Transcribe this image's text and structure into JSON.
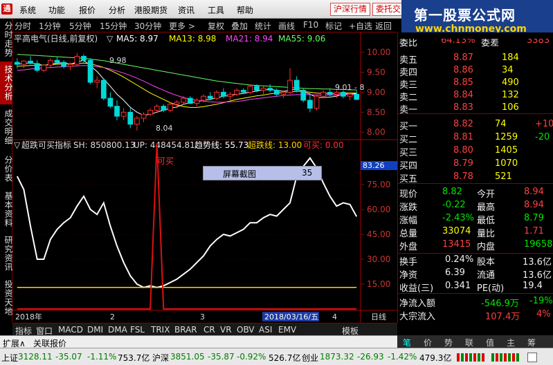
{
  "menubar": {
    "logo": "通",
    "items": [
      "系统",
      "功能",
      "报价",
      "分析",
      "港股期货",
      "资讯",
      "工具",
      "帮助"
    ],
    "btn_sh": "沪深行情",
    "btn_order": "委托交"
  },
  "watermark": {
    "line1": "第一股票公式网",
    "line2": "www.chnmoney.com"
  },
  "toolbar": {
    "left": [
      "分时",
      "1分钟",
      "5分钟",
      "15分钟",
      "30分钟",
      "更多 >"
    ],
    "right": [
      "复权",
      "叠加",
      "统计",
      "画线",
      "F10",
      "标记",
      "+自选",
      "返回"
    ]
  },
  "sidetabs": [
    "分时走势",
    "技术分析",
    "成交明细",
    "分价表",
    "基本资料",
    "研究资讯",
    "投资天地"
  ],
  "chart_info": {
    "stock": "平高电气(日线,前复权)",
    "ma5_label": "MA5: 8.97",
    "ma13_label": "MA13: 8.98",
    "ma21_label": "MA21: 8.94",
    "ma55_label": "MA55: 9.06",
    "hi_label": "9.98",
    "lo_label": "8.04",
    "last_label": "9.01 - 8"
  },
  "indicator_info": {
    "name": "超跌可买指标",
    "sh": "SH: 850800.13",
    "up": "UP: 448454.81",
    "trend": "趋势线: 55.73",
    "oversold": "超跌线: 13.00",
    "buy": "可买: 0.00",
    "buy_marker": "可买",
    "value_tag": "83.26"
  },
  "dialog": {
    "label": "屏幕截图",
    "value": "35"
  },
  "xaxis": {
    "year": "2018年",
    "m2": "2",
    "m3": "3",
    "date": "2018/03/16/五",
    "m4": "4",
    "period": "日线"
  },
  "bottomtabs": [
    "指标",
    "窗口",
    "MACD",
    "DMI",
    "DMA",
    "FSL",
    "TRIX",
    "BRAR",
    "CR",
    "VR",
    "OBV",
    "ASI",
    "EMV"
  ],
  "bottom_right": "模板",
  "expand": {
    "a": "扩展∧",
    "b": "关联报价"
  },
  "rtabs": [
    "笔",
    "价",
    "势",
    "联",
    "值",
    "主",
    "筹"
  ],
  "quote": {
    "weibi_label": "委比",
    "weibi": "64.13%",
    "weicha_label": "委差",
    "weicha": "3383",
    "sell": [
      {
        "label": "卖五",
        "price": "8.87",
        "vol": "184"
      },
      {
        "label": "卖四",
        "price": "8.86",
        "vol": "34"
      },
      {
        "label": "卖三",
        "price": "8.85",
        "vol": "490"
      },
      {
        "label": "卖二",
        "price": "8.84",
        "vol": "132"
      },
      {
        "label": "卖一",
        "price": "8.83",
        "vol": "106"
      }
    ],
    "buy": [
      {
        "label": "买一",
        "price": "8.82",
        "vol": "74",
        "chg": "+10"
      },
      {
        "label": "买二",
        "price": "8.81",
        "vol": "1259",
        "chg": "-20"
      },
      {
        "label": "买三",
        "price": "8.80",
        "vol": "1405",
        "chg": ""
      },
      {
        "label": "买四",
        "price": "8.79",
        "vol": "1070",
        "chg": ""
      },
      {
        "label": "买五",
        "price": "8.78",
        "vol": "521",
        "chg": ""
      }
    ],
    "stats": [
      {
        "l1": "现价",
        "v1": "8.82",
        "c1": "green",
        "l2": "今开",
        "v2": "8.94",
        "c2": "red"
      },
      {
        "l1": "涨跌",
        "v1": "-0.22",
        "c1": "green",
        "l2": "最高",
        "v2": "8.94",
        "c2": "red"
      },
      {
        "l1": "涨幅",
        "v1": "-2.43%",
        "c1": "green",
        "l2": "最低",
        "v2": "8.79",
        "c2": "green"
      },
      {
        "l1": "总量",
        "v1": "33074",
        "c1": "yellow",
        "l2": "量比",
        "v2": "1.71",
        "c2": "red"
      },
      {
        "l1": "外盘",
        "v1": "13415",
        "c1": "red",
        "l2": "内盘",
        "v2": "19658",
        "c2": "green"
      }
    ],
    "stats2": [
      {
        "l1": "换手",
        "v1": "0.24%",
        "l2": "股本",
        "v2": "13.6亿"
      },
      {
        "l1": "净资",
        "v1": "6.39",
        "l2": "流通",
        "v2": "13.6亿"
      },
      {
        "l1": "收益(三)",
        "v1": "0.341",
        "l2": "PE(动)",
        "v2": "19.4"
      }
    ],
    "inflow_label": "净流入额",
    "inflow": "-546.9万",
    "inflow_pct": "-19%",
    "block_label": "大宗流入",
    "block": "107.4万",
    "block_pct": "4%"
  },
  "statusbar": {
    "sh_label": "上证",
    "sh_val": "3128.11",
    "sh_chg": "-35.07",
    "sh_pct": "-1.11%",
    "sh_amt": "753.7亿",
    "sz_label": "沪深",
    "sz_val": "3851.05",
    "sz_chg": "-35.87",
    "sz_pct": "-0.92%",
    "sz_amt": "526.7亿",
    "cy_label": "创业",
    "cy_val": "1873.32",
    "cy_chg": "-26.93",
    "cy_pct": "-1.42%",
    "cy_amt": "479.3亿"
  },
  "chart_data": {
    "type": "line",
    "price_axis": {
      "ticks": [
        "10.00",
        "9.50",
        "9.00",
        "8.50",
        "8.00"
      ]
    },
    "indicator_axis": {
      "ticks": [
        "75.00",
        "60.00",
        "45.00",
        "30.00",
        "15.00"
      ]
    },
    "candles": [
      {
        "o": 9.75,
        "h": 9.85,
        "l": 9.6,
        "c": 9.7
      },
      {
        "o": 9.7,
        "h": 9.8,
        "l": 9.6,
        "c": 9.78
      },
      {
        "o": 9.78,
        "h": 9.9,
        "l": 9.7,
        "c": 9.72
      },
      {
        "o": 9.72,
        "h": 9.8,
        "l": 9.5,
        "c": 9.55
      },
      {
        "o": 9.55,
        "h": 9.7,
        "l": 9.5,
        "c": 9.68
      },
      {
        "o": 9.68,
        "h": 9.85,
        "l": 9.6,
        "c": 9.8
      },
      {
        "o": 9.8,
        "h": 9.9,
        "l": 9.7,
        "c": 9.75
      },
      {
        "o": 9.75,
        "h": 9.8,
        "l": 9.6,
        "c": 9.65
      },
      {
        "o": 9.65,
        "h": 9.75,
        "l": 9.55,
        "c": 9.7
      },
      {
        "o": 9.7,
        "h": 9.98,
        "l": 9.65,
        "c": 9.9
      },
      {
        "o": 9.9,
        "h": 9.95,
        "l": 9.75,
        "c": 9.8
      },
      {
        "o": 9.8,
        "h": 9.85,
        "l": 9.2,
        "c": 9.25
      },
      {
        "o": 9.25,
        "h": 9.4,
        "l": 9.1,
        "c": 9.3
      },
      {
        "o": 9.3,
        "h": 9.35,
        "l": 8.8,
        "c": 8.85
      },
      {
        "o": 8.85,
        "h": 9.0,
        "l": 8.6,
        "c": 8.65
      },
      {
        "o": 8.65,
        "h": 8.8,
        "l": 8.3,
        "c": 8.4
      },
      {
        "o": 8.4,
        "h": 8.6,
        "l": 8.3,
        "c": 8.5
      },
      {
        "o": 8.5,
        "h": 8.6,
        "l": 8.1,
        "c": 8.2
      },
      {
        "o": 8.2,
        "h": 8.4,
        "l": 8.04,
        "c": 8.35
      },
      {
        "o": 8.35,
        "h": 8.5,
        "l": 8.25,
        "c": 8.45
      },
      {
        "o": 8.45,
        "h": 8.6,
        "l": 8.4,
        "c": 8.55
      },
      {
        "o": 8.55,
        "h": 8.7,
        "l": 8.5,
        "c": 8.65
      },
      {
        "o": 8.65,
        "h": 8.7,
        "l": 8.5,
        "c": 8.55
      },
      {
        "o": 8.55,
        "h": 8.75,
        "l": 8.5,
        "c": 8.7
      },
      {
        "o": 8.7,
        "h": 8.8,
        "l": 8.6,
        "c": 8.75
      },
      {
        "o": 8.75,
        "h": 8.9,
        "l": 8.7,
        "c": 8.85
      },
      {
        "o": 8.85,
        "h": 8.9,
        "l": 8.7,
        "c": 8.72
      },
      {
        "o": 8.72,
        "h": 8.85,
        "l": 8.65,
        "c": 8.8
      },
      {
        "o": 8.8,
        "h": 8.95,
        "l": 8.75,
        "c": 8.9
      },
      {
        "o": 8.9,
        "h": 9.0,
        "l": 8.8,
        "c": 8.85
      },
      {
        "o": 8.85,
        "h": 9.05,
        "l": 8.8,
        "c": 9.0
      },
      {
        "o": 9.0,
        "h": 9.1,
        "l": 8.85,
        "c": 8.9
      },
      {
        "o": 8.9,
        "h": 9.0,
        "l": 8.8,
        "c": 8.95
      },
      {
        "o": 8.95,
        "h": 9.1,
        "l": 8.9,
        "c": 9.05
      },
      {
        "o": 9.05,
        "h": 9.1,
        "l": 8.95,
        "c": 9.0
      },
      {
        "o": 9.0,
        "h": 9.2,
        "l": 8.95,
        "c": 9.15
      },
      {
        "o": 9.15,
        "h": 9.2,
        "l": 9.0,
        "c": 9.05
      },
      {
        "o": 9.05,
        "h": 9.15,
        "l": 8.95,
        "c": 9.1
      },
      {
        "o": 9.1,
        "h": 9.2,
        "l": 9.0,
        "c": 9.05
      },
      {
        "o": 9.05,
        "h": 9.1,
        "l": 8.9,
        "c": 8.95
      },
      {
        "o": 8.95,
        "h": 9.05,
        "l": 8.85,
        "c": 9.0
      },
      {
        "o": 9.0,
        "h": 9.6,
        "l": 8.95,
        "c": 9.3
      },
      {
        "o": 9.3,
        "h": 9.4,
        "l": 9.0,
        "c": 9.05
      },
      {
        "o": 9.05,
        "h": 9.1,
        "l": 8.75,
        "c": 8.8
      },
      {
        "o": 8.8,
        "h": 9.0,
        "l": 8.5,
        "c": 8.6
      },
      {
        "o": 8.6,
        "h": 8.95,
        "l": 8.55,
        "c": 8.9
      },
      {
        "o": 8.9,
        "h": 9.05,
        "l": 8.85,
        "c": 9.0
      },
      {
        "o": 9.0,
        "h": 9.1,
        "l": 8.9,
        "c": 8.95
      },
      {
        "o": 8.95,
        "h": 9.05,
        "l": 8.85,
        "c": 9.0
      },
      {
        "o": 9.0,
        "h": 9.05,
        "l": 8.85,
        "c": 8.9
      },
      {
        "o": 8.9,
        "h": 9.0,
        "l": 8.8,
        "c": 8.95
      },
      {
        "o": 8.95,
        "h": 9.05,
        "l": 8.8,
        "c": 8.82
      }
    ],
    "ma_series": [
      {
        "name": "MA5",
        "color": "#ffffff",
        "values": [
          9.7,
          9.72,
          9.74,
          9.7,
          9.68,
          9.7,
          9.73,
          9.74,
          9.7,
          9.76,
          9.8,
          9.66,
          9.52,
          9.33,
          9.15,
          8.95,
          8.8,
          8.62,
          8.5,
          8.42,
          8.45,
          8.5,
          8.55,
          8.6,
          8.63,
          8.7,
          8.74,
          8.76,
          8.8,
          8.82,
          8.86,
          8.9,
          8.92,
          8.95,
          8.97,
          9.0,
          9.03,
          9.06,
          9.07,
          9.05,
          9.02,
          9.06,
          9.08,
          9.02,
          8.95,
          8.87,
          8.87,
          8.88,
          8.9,
          8.96,
          8.95,
          8.97
        ]
      },
      {
        "name": "MA13",
        "color": "#ffff00",
        "values": [
          9.65,
          9.66,
          9.67,
          9.68,
          9.68,
          9.69,
          9.7,
          9.71,
          9.71,
          9.72,
          9.73,
          9.71,
          9.67,
          9.62,
          9.55,
          9.47,
          9.38,
          9.28,
          9.18,
          9.08,
          8.98,
          8.9,
          8.82,
          8.74,
          8.68,
          8.64,
          8.62,
          8.62,
          8.64,
          8.67,
          8.7,
          8.74,
          8.78,
          8.82,
          8.85,
          8.88,
          8.91,
          8.93,
          8.96,
          8.98,
          9.0,
          9.01,
          9.02,
          9.02,
          9.0,
          8.98,
          8.97,
          8.97,
          8.97,
          8.98,
          8.98,
          8.98
        ]
      },
      {
        "name": "MA21",
        "color": "#ff44ff",
        "values": [
          9.55,
          9.56,
          9.58,
          9.6,
          9.61,
          9.62,
          9.63,
          9.64,
          9.65,
          9.66,
          9.67,
          9.66,
          9.64,
          9.62,
          9.58,
          9.53,
          9.48,
          9.42,
          9.35,
          9.28,
          9.2,
          9.12,
          9.05,
          8.98,
          8.92,
          8.87,
          8.83,
          8.8,
          8.78,
          8.76,
          8.75,
          8.75,
          8.76,
          8.77,
          8.79,
          8.82,
          8.84,
          8.86,
          8.88,
          8.9,
          8.92,
          8.93,
          8.94,
          8.94,
          8.94,
          8.93,
          8.93,
          8.93,
          8.93,
          8.94,
          8.94,
          8.94
        ]
      },
      {
        "name": "MA55",
        "color": "#66ff66",
        "values": [
          9.95,
          9.94,
          9.93,
          9.92,
          9.91,
          9.9,
          9.89,
          9.88,
          9.87,
          9.86,
          9.85,
          9.83,
          9.81,
          9.79,
          9.76,
          9.73,
          9.7,
          9.67,
          9.64,
          9.61,
          9.58,
          9.55,
          9.52,
          9.49,
          9.46,
          9.43,
          9.4,
          9.37,
          9.34,
          9.31,
          9.28,
          9.26,
          9.24,
          9.22,
          9.2,
          9.18,
          9.17,
          9.16,
          9.15,
          9.14,
          9.13,
          9.12,
          9.11,
          9.1,
          9.09,
          9.09,
          9.08,
          9.08,
          9.07,
          9.07,
          9.06,
          9.06
        ]
      }
    ],
    "indicator_series": [
      {
        "name": "趋势线",
        "color": "#ffffff",
        "values": [
          80,
          72,
          50,
          30,
          30,
          42,
          48,
          52,
          55,
          62,
          68,
          60,
          57,
          64,
          50,
          38,
          28,
          20,
          15,
          13,
          14,
          13,
          14,
          16,
          18,
          21,
          24,
          28,
          32,
          38,
          42,
          45,
          44,
          46,
          48,
          52,
          52,
          55,
          57,
          56,
          60,
          64,
          80,
          86,
          91,
          85,
          76,
          68,
          62,
          64,
          63,
          55.73
        ]
      },
      {
        "name": "超跌线",
        "color": "#ffd700",
        "values": [
          13,
          13,
          13,
          13,
          13,
          13,
          13,
          13,
          13,
          13,
          13,
          13,
          13,
          13,
          13,
          13,
          13,
          13,
          13,
          13,
          13,
          13,
          13,
          13,
          13,
          13,
          13,
          13,
          13,
          13,
          13,
          13,
          13,
          13,
          13,
          13,
          13,
          13,
          13,
          13,
          13,
          13,
          13,
          13,
          13,
          13,
          13,
          13,
          13,
          13,
          13,
          13
        ]
      },
      {
        "name": "可买",
        "color": "#dd1111",
        "values": [
          0,
          0,
          0,
          0,
          0,
          0,
          0,
          0,
          0,
          0,
          0,
          0,
          0,
          0,
          0,
          0,
          0,
          0,
          0,
          0,
          0,
          100,
          0,
          0,
          0,
          0,
          0,
          0,
          0,
          0,
          0,
          0,
          0,
          0,
          0,
          0,
          0,
          0,
          0,
          0,
          0,
          0,
          0,
          0,
          0,
          0,
          0,
          0,
          0,
          0,
          0,
          0
        ]
      }
    ],
    "price_ylim": [
      7.9,
      10.15
    ],
    "ind_ylim": [
      0,
      95
    ]
  }
}
